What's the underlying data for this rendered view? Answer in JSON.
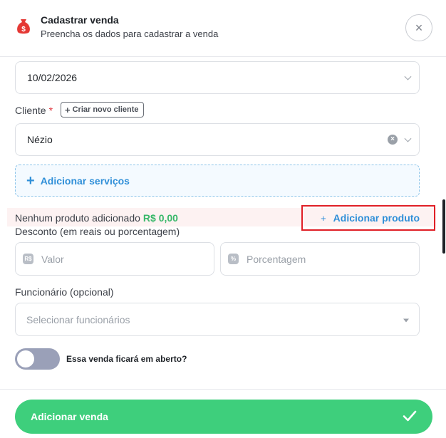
{
  "header": {
    "title": "Cadastrar venda",
    "subtitle": "Preencha os dados para cadastrar a venda",
    "close_symbol": "×"
  },
  "date_field": {
    "value": "10/02/2026"
  },
  "client": {
    "label": "Cliente",
    "required_mark": "*",
    "create_button": "Criar novo cliente",
    "value": "Nézio"
  },
  "services": {
    "button_label": "Adicionar serviços"
  },
  "products": {
    "empty_text": "Nenhum produto adicionado",
    "total": "R$ 0,00",
    "add_button": "Adicionar produto"
  },
  "discount": {
    "label": "Desconto (em reais ou porcentagem)",
    "value_placeholder": "Valor",
    "value_icon": "R$",
    "percent_placeholder": "Porcentagem",
    "percent_icon": "%"
  },
  "employee": {
    "label": "Funcionário (opcional)",
    "placeholder": "Selecionar funcionários"
  },
  "open_sale": {
    "label": "Essa venda ficará em aberto?",
    "enabled": false
  },
  "submit": {
    "label": "Adicionar venda"
  },
  "colors": {
    "accent_green": "#3ecf7c",
    "accent_blue": "#2f8fd8",
    "highlight_red": "#e01f26",
    "money_red": "#e53935"
  }
}
